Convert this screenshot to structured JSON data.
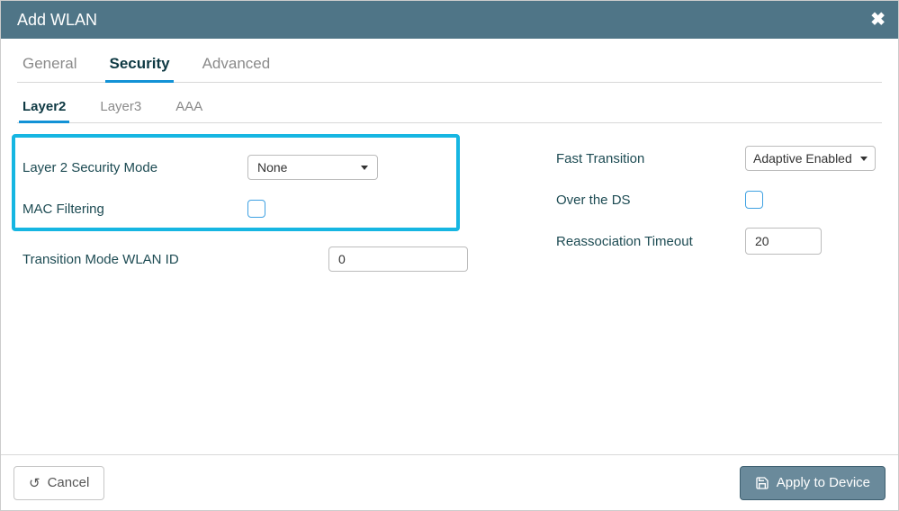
{
  "modal": {
    "title": "Add WLAN"
  },
  "tabs": {
    "general": "General",
    "security": "Security",
    "advanced": "Advanced"
  },
  "subtabs": {
    "layer2": "Layer2",
    "layer3": "Layer3",
    "aaa": "AAA"
  },
  "left": {
    "l2_security_mode_label": "Layer 2 Security Mode",
    "l2_security_mode_value": "None",
    "mac_filtering_label": "MAC Filtering",
    "transition_mode_label": "Transition Mode WLAN ID",
    "transition_mode_value": "0"
  },
  "right": {
    "fast_transition_label": "Fast Transition",
    "fast_transition_value": "Adaptive Enabled",
    "over_the_ds_label": "Over the DS",
    "reassoc_timeout_label": "Reassociation Timeout",
    "reassoc_timeout_value": "20"
  },
  "footer": {
    "cancel": "Cancel",
    "apply": "Apply to Device"
  }
}
